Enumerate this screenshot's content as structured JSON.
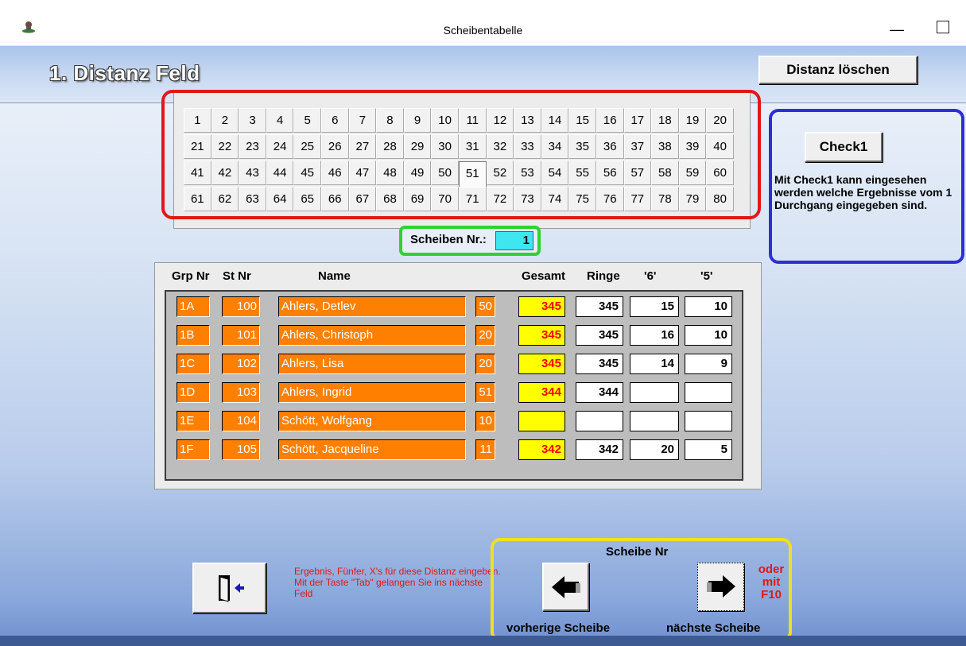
{
  "window": {
    "title": "Scheibentabelle",
    "minimize": "—"
  },
  "header": {
    "title": "1. Distanz Feld",
    "delete_button": "Distanz löschen"
  },
  "grid": {
    "rows": [
      [
        "1",
        "2",
        "3",
        "4",
        "5",
        "6",
        "7",
        "8",
        "9",
        "10",
        "11",
        "12",
        "13",
        "14",
        "15",
        "16",
        "17",
        "18",
        "19",
        "20"
      ],
      [
        "21",
        "22",
        "23",
        "24",
        "25",
        "26",
        "27",
        "28",
        "29",
        "30",
        "31",
        "32",
        "33",
        "34",
        "35",
        "36",
        "37",
        "38",
        "39",
        "40"
      ],
      [
        "41",
        "42",
        "43",
        "44",
        "45",
        "46",
        "47",
        "48",
        "49",
        "50",
        "51",
        "52",
        "53",
        "54",
        "55",
        "56",
        "57",
        "58",
        "59",
        "60"
      ],
      [
        "61",
        "62",
        "63",
        "64",
        "65",
        "66",
        "67",
        "68",
        "69",
        "70",
        "71",
        "72",
        "73",
        "74",
        "75",
        "76",
        "77",
        "78",
        "79",
        "80"
      ]
    ],
    "selected": "51"
  },
  "check": {
    "button": "Check1",
    "text": "Mit Check1 kann eingesehen werden welche Ergebnisse vom 1 Durchgang eingegeben sind."
  },
  "scheiben": {
    "label": "Scheiben Nr.:",
    "value": "1"
  },
  "table": {
    "headers": {
      "grp": "Grp Nr",
      "st": "St Nr",
      "name": "Name",
      "gesamt": "Gesamt",
      "ringe": "Ringe",
      "six": "'6'",
      "five": "'5'"
    },
    "rows": [
      {
        "grp": "1A",
        "st": "100",
        "name": "Ahlers, Detlev",
        "count": "50",
        "gesamt": "345",
        "ringe": "345",
        "six": "15",
        "five": "10"
      },
      {
        "grp": "1B",
        "st": "101",
        "name": "Ahlers, Christoph",
        "count": "20",
        "gesamt": "345",
        "ringe": "345",
        "six": "16",
        "five": "10"
      },
      {
        "grp": "1C",
        "st": "102",
        "name": "Ahlers, Lisa",
        "count": "20",
        "gesamt": "345",
        "ringe": "345",
        "six": "14",
        "five": "9"
      },
      {
        "grp": "1D",
        "st": "103",
        "name": "Ahlers, Ingrid",
        "count": "51",
        "gesamt": "344",
        "ringe": "344",
        "six": "",
        "five": ""
      },
      {
        "grp": "1E",
        "st": "104",
        "name": "Schött, Wolfgang",
        "count": "10",
        "gesamt": "",
        "ringe": "",
        "six": "",
        "five": ""
      },
      {
        "grp": "1F",
        "st": "105",
        "name": "Schött, Jacqueline",
        "count": "11",
        "gesamt": "342",
        "ringe": "342",
        "six": "20",
        "five": "5"
      }
    ]
  },
  "info": "Ergebnis, Fünfer, X's für diese Distanz eingeben. Mit der Taste \"Tab\" gelangen Sie ins nächste Feld",
  "nav": {
    "title": "Scheibe Nr",
    "oder": "oder",
    "mit": "mit",
    "key": "F10",
    "prev_label": "vorherige Scheibe",
    "next_label": "nächste Scheibe"
  },
  "icons": {
    "app": "shooter-icon",
    "exit": "exit-door-icon",
    "prev": "arrow-left-icon",
    "next": "arrow-right-icon"
  },
  "colors": {
    "highlight_red": "#e01818",
    "highlight_blue": "#2d2ed8",
    "highlight_green": "#2fd22f",
    "highlight_yellow": "#f2e01a",
    "field_orange": "#ff8000",
    "gesamt_yellow": "#ffff00",
    "scheiben_cyan": "#3fe6ef"
  }
}
